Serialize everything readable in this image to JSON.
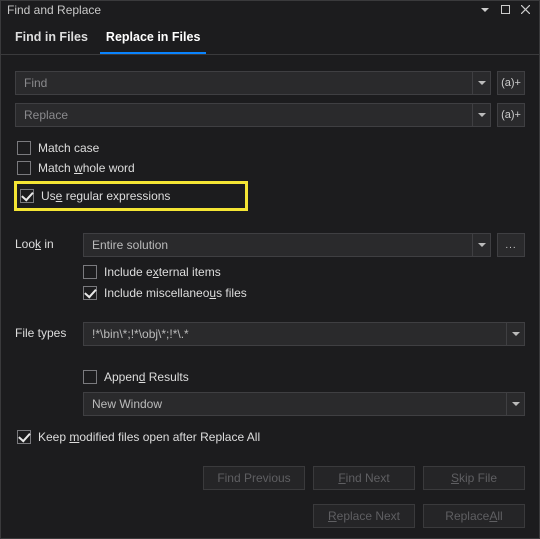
{
  "window": {
    "title": "Find and Replace"
  },
  "tabs": {
    "find": "Find in Files",
    "replace": "Replace in Files"
  },
  "find": {
    "placeholder": "Find",
    "btn": "(a)+"
  },
  "replace": {
    "placeholder": "Replace",
    "btn": "(a)+"
  },
  "opts": {
    "match_case": "Match case",
    "whole_word_pre": "Match ",
    "whole_word_u": "w",
    "whole_word_post": "hole word",
    "regex_pre": "Us",
    "regex_u": "e",
    "regex_post": " regular expressions"
  },
  "lookin": {
    "label_pre": "Loo",
    "label_u": "k",
    "label_post": " in",
    "value": "Entire solution",
    "ext_pre": "Include e",
    "ext_u": "x",
    "ext_post": "ternal items",
    "misc_pre": "Include miscellaneo",
    "misc_u": "u",
    "misc_post": "s files"
  },
  "filetypes": {
    "label": "File types",
    "value": "!*\\bin\\*;!*\\obj\\*;!*\\.*"
  },
  "results": {
    "append_pre": "Appen",
    "append_u": "d",
    "append_post": " Results",
    "window": "New Window",
    "keep_pre": "Keep ",
    "keep_u": "m",
    "keep_post": "odified files open after Replace All"
  },
  "buttons": {
    "find_prev": "Find Previous",
    "find_next_u": "F",
    "find_next_post": "ind Next",
    "skip_u": "S",
    "skip_post": "kip File",
    "rep_next_u": "R",
    "rep_next_post": "eplace Next",
    "rep_all_pre": "Replace ",
    "rep_all_u": "A",
    "rep_all_post": "ll"
  }
}
